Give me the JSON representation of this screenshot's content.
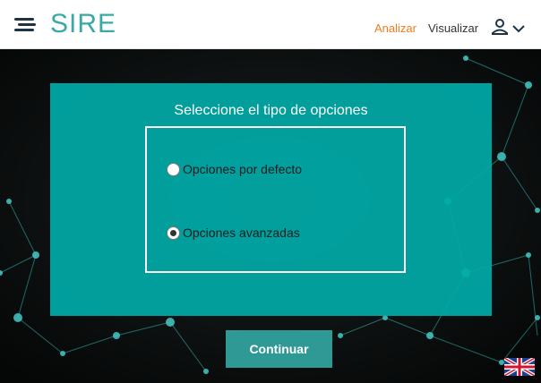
{
  "header": {
    "logo": "SIRE",
    "nav": {
      "analizar": "Analizar",
      "visualizar": "Visualizar"
    }
  },
  "icons": {
    "menu": "hamburger-menu-icon",
    "user": "user-icon",
    "dropdown": "chevron-down-icon",
    "language": "uk-flag-icon"
  },
  "dialog": {
    "title": "Seleccione el tipo de opciones",
    "options": [
      {
        "label": "Opciones por defecto",
        "selected": false
      },
      {
        "label": "Opciones avanzadas",
        "selected": true
      }
    ]
  },
  "continue_button": "Continuar",
  "colors": {
    "brand": "#3aa9a6",
    "active_nav": "#ee7d1e",
    "panel": "#00aaa8",
    "button": "#2f9a95"
  }
}
